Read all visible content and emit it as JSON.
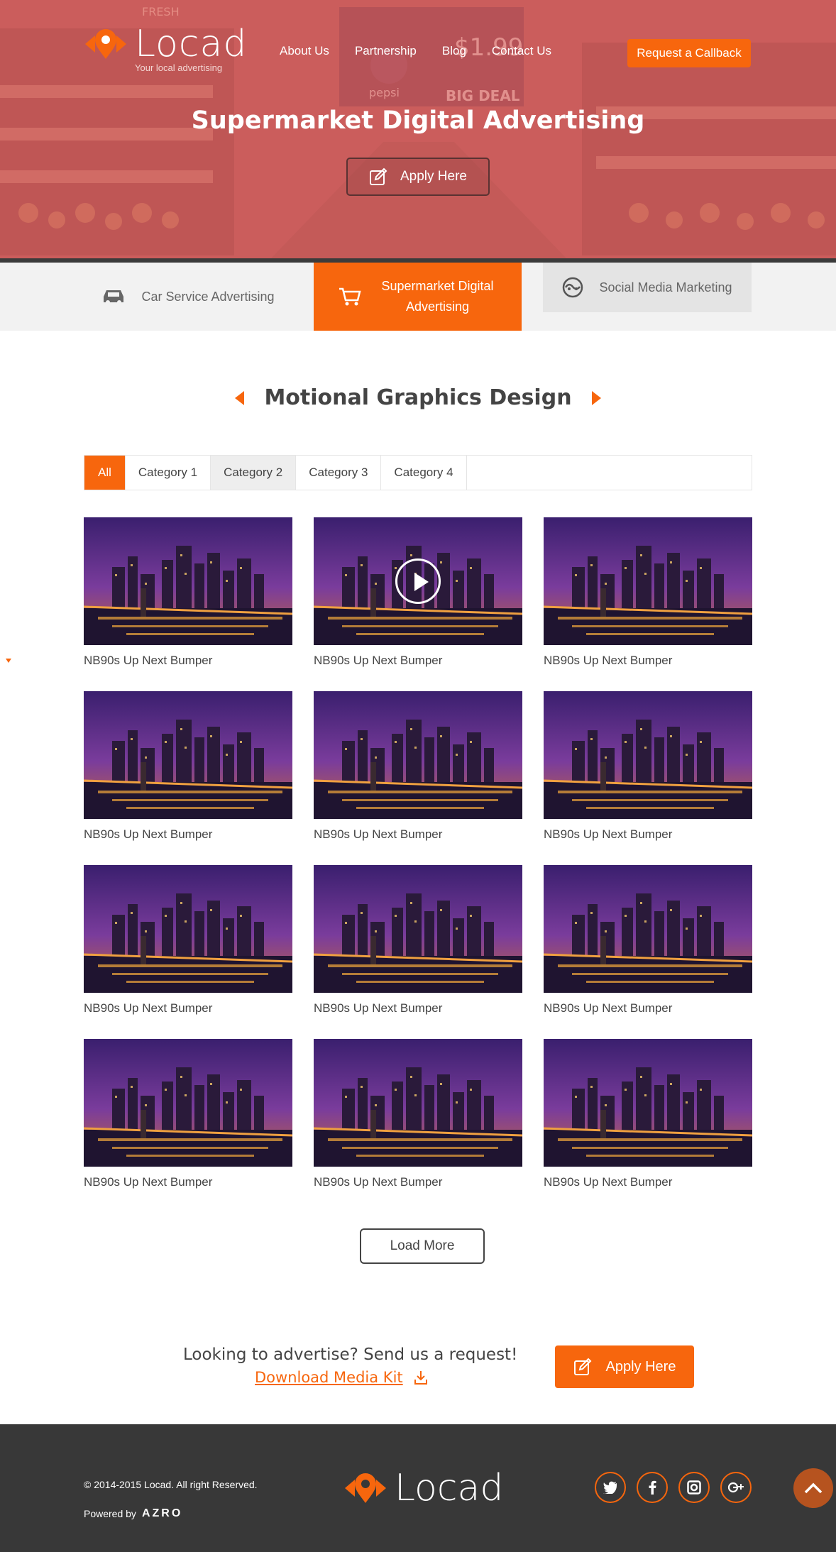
{
  "brand": {
    "name": "Locad",
    "tagline": "Your local advertising",
    "accent": "#f7660d",
    "dark": "#383838"
  },
  "nav": {
    "items": [
      "About Us",
      "Partnership",
      "Blog",
      "Contact Us"
    ],
    "callback_label": "Request a Callback"
  },
  "hero": {
    "title": "Supermarket Digital Advertising",
    "apply_label": "Apply Here",
    "background_sign_texts": [
      "FRESH",
      "$1.99",
      "pepsi",
      "BIG DEAL"
    ]
  },
  "services": [
    {
      "label": "Car Service Advertising",
      "icon": "car-icon",
      "active": false
    },
    {
      "label": "Supermarket Digital Advertising",
      "icon": "cart-icon",
      "active": true
    },
    {
      "label": "Social Media Marketing",
      "icon": "globe-icon",
      "active": false
    }
  ],
  "section": {
    "title": "Motional Graphics Design"
  },
  "filters": [
    "All",
    "Category 1",
    "Category 2",
    "Category 3",
    "Category 4"
  ],
  "grid": {
    "caption": "NB90s Up Next Bumper",
    "items": [
      {
        "caption": "NB90s Up Next Bumper",
        "video": false
      },
      {
        "caption": "NB90s Up Next Bumper",
        "video": true
      },
      {
        "caption": "NB90s Up Next Bumper",
        "video": false
      },
      {
        "caption": "NB90s Up Next Bumper",
        "video": false
      },
      {
        "caption": "NB90s Up Next Bumper",
        "video": false
      },
      {
        "caption": "NB90s Up Next Bumper",
        "video": false
      },
      {
        "caption": "NB90s Up Next Bumper",
        "video": false
      },
      {
        "caption": "NB90s Up Next Bumper",
        "video": false
      },
      {
        "caption": "NB90s Up Next Bumper",
        "video": false
      },
      {
        "caption": "NB90s Up Next Bumper",
        "video": false
      },
      {
        "caption": "NB90s Up Next Bumper",
        "video": false
      },
      {
        "caption": "NB90s Up Next Bumper",
        "video": false
      }
    ],
    "load_more_label": "Load More"
  },
  "cta": {
    "text": "Looking to advertise? Send us a request!",
    "download_label": "Download Media Kit",
    "apply_label": "Apply Here"
  },
  "footer": {
    "copyright": "© 2014-2015 Locad. All right Reserved.",
    "powered_by": "Powered by",
    "powered_brand": "AZRO",
    "socials": [
      "twitter-icon",
      "facebook-icon",
      "instagram-icon",
      "google-plus-icon"
    ]
  }
}
